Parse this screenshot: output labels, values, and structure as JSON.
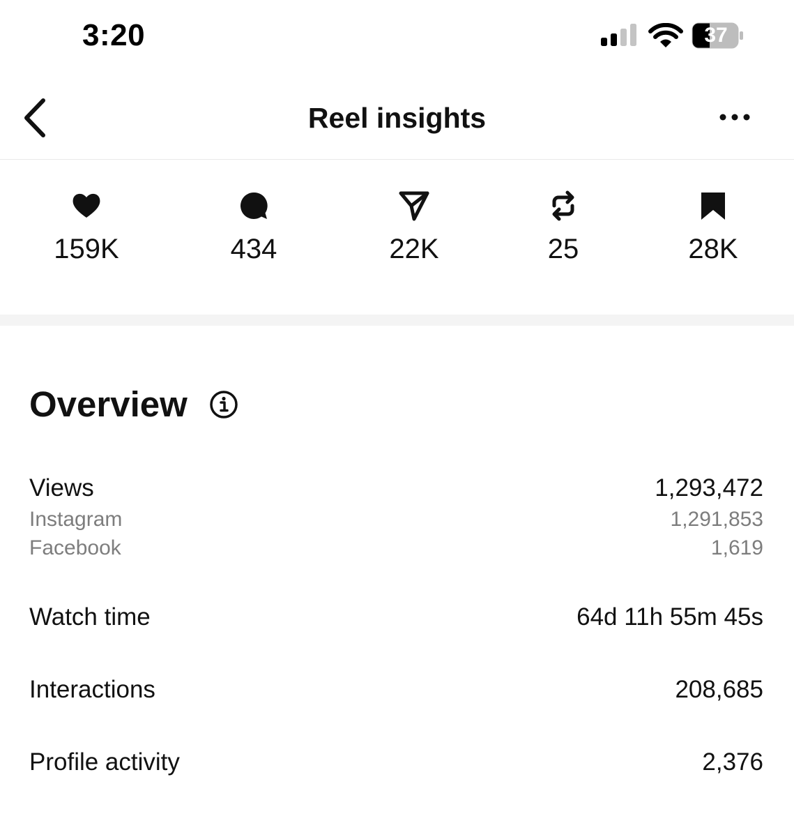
{
  "status_bar": {
    "time": "3:20",
    "battery": "37",
    "icons": [
      "cellular-signal-icon",
      "wifi-icon",
      "battery-icon"
    ]
  },
  "header": {
    "title": "Reel insights",
    "back_icon": "chevron-left-icon",
    "more_icon": "more-horizontal-icon"
  },
  "stats": [
    {
      "icon": "heart-icon",
      "value": "159K"
    },
    {
      "icon": "comment-icon",
      "value": "434"
    },
    {
      "icon": "send-icon",
      "value": "22K"
    },
    {
      "icon": "repost-icon",
      "value": "25"
    },
    {
      "icon": "bookmark-icon",
      "value": "28K"
    }
  ],
  "overview": {
    "title": "Overview",
    "info_icon": "info-icon",
    "views": {
      "label": "Views",
      "value": "1,293,472",
      "breakdown": [
        {
          "label": "Instagram",
          "value": "1,291,853"
        },
        {
          "label": "Facebook",
          "value": "1,619"
        }
      ]
    },
    "watch_time": {
      "label": "Watch time",
      "value": "64d 11h 55m 45s"
    },
    "interactions": {
      "label": "Interactions",
      "value": "208,685"
    },
    "profile_activity": {
      "label": "Profile activity",
      "value": "2,376"
    }
  },
  "colors": {
    "text_primary": "#111111",
    "text_secondary": "#7d7d7d",
    "divider": "#f4f4f4",
    "battery_fill": "#000000"
  }
}
